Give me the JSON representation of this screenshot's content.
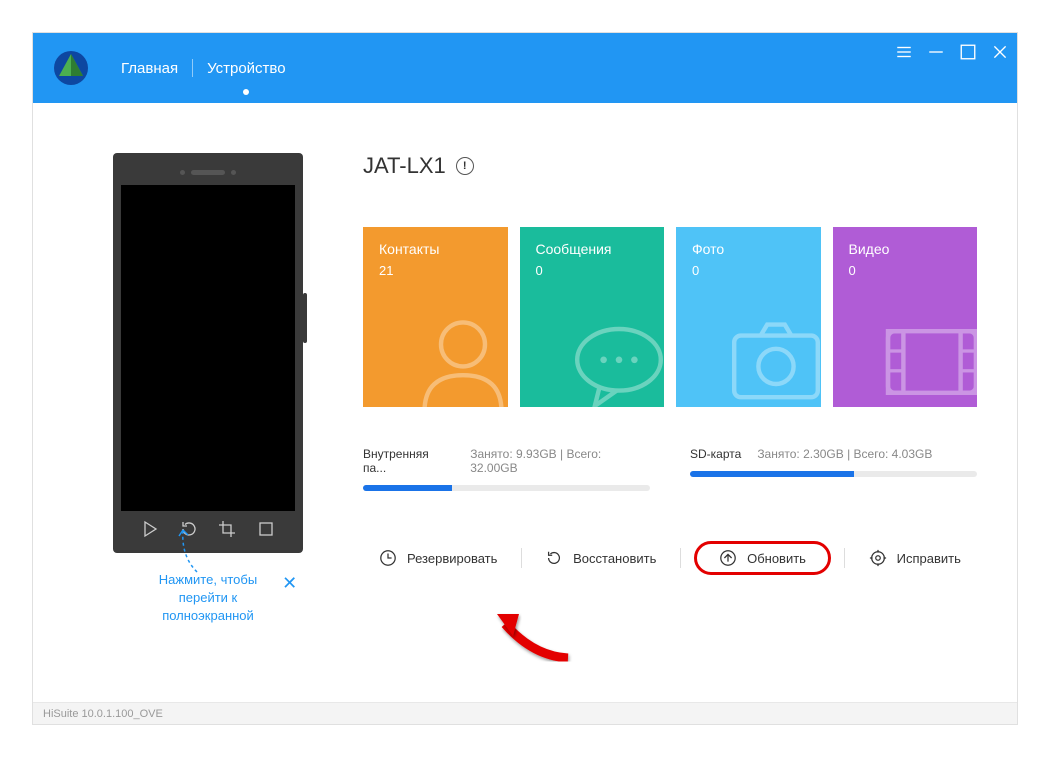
{
  "header": {
    "nav": {
      "home": "Главная",
      "device": "Устройство"
    }
  },
  "device": {
    "name": "JAT-LX1"
  },
  "tiles": {
    "contacts": {
      "label": "Контакты",
      "count": "21",
      "color": "#f39a2e"
    },
    "messages": {
      "label": "Сообщения",
      "count": "0",
      "color": "#1abc9c"
    },
    "photos": {
      "label": "Фото",
      "count": "0",
      "color": "#4fc3f7"
    },
    "videos": {
      "label": "Видео",
      "count": "0",
      "color": "#b05cd6"
    }
  },
  "storage": {
    "internal": {
      "name": "Внутренняя па...",
      "stats": "Занято: 9.93GB | Всего: 32.00GB",
      "pct": 31
    },
    "sd": {
      "name": "SD-карта",
      "stats": "Занято: 2.30GB | Всего: 4.03GB",
      "pct": 57
    }
  },
  "actions": {
    "backup": "Резервировать",
    "restore": "Восстановить",
    "update": "Обновить",
    "repair": "Исправить"
  },
  "hint": {
    "line1": "Нажмите, чтобы",
    "line2": "перейти к",
    "line3": "полноэкранной"
  },
  "footer": {
    "version": "HiSuite 10.0.1.100_OVE"
  }
}
